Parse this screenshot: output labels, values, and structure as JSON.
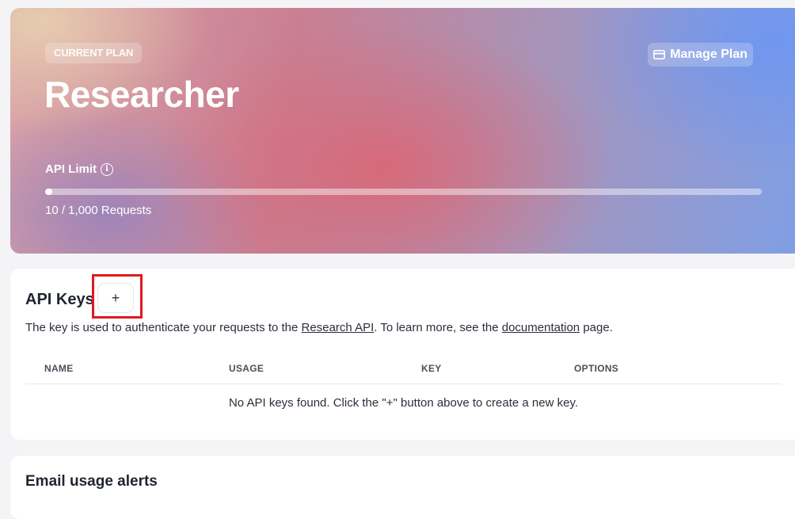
{
  "plan": {
    "badge": "CURRENT PLAN",
    "manage_label": "Manage Plan",
    "name": "Researcher",
    "limit_label": "API Limit",
    "requests_text": "10 / 1,000 Requests",
    "progress_fraction": 0.01
  },
  "api_keys": {
    "title": "API Keys",
    "add_label": "+",
    "desc_before": "The key is used to authenticate your requests to the ",
    "desc_link1": "Research API",
    "desc_middle": ". To learn more, see the ",
    "desc_link2": "documentation",
    "desc_after": " page.",
    "columns": [
      "NAME",
      "USAGE",
      "KEY",
      "OPTIONS"
    ],
    "empty_message": "No API keys found. Click the \"+\" button above to create a new key."
  },
  "alerts": {
    "title": "Email usage alerts"
  },
  "colors": {
    "highlight": "#e0191f"
  }
}
